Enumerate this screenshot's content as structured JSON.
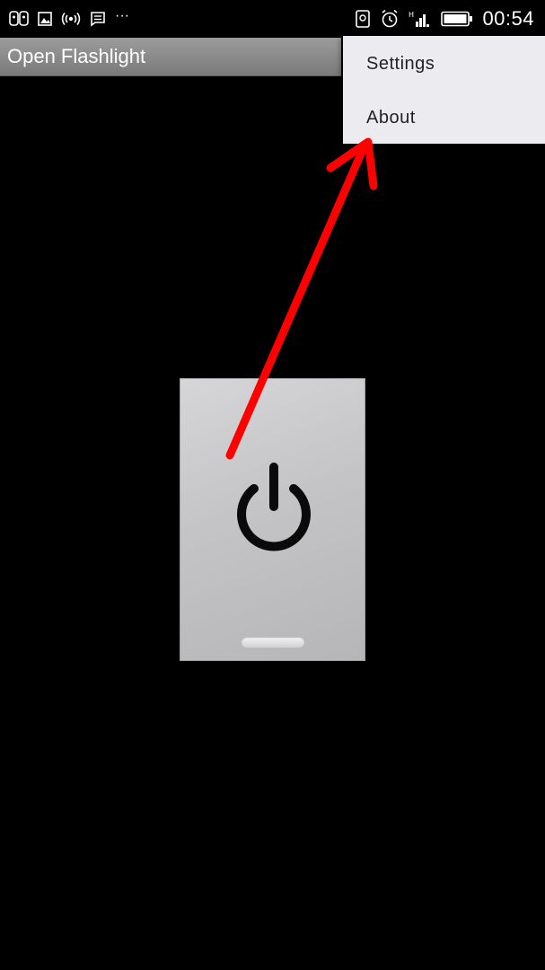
{
  "status_bar": {
    "time": "00:54",
    "overflow_indicator": "···",
    "left_icons": [
      "voicemail-icon",
      "gallery-icon",
      "hotspot-icon",
      "message-icon"
    ],
    "right_icons": [
      "sim-icon",
      "alarm-icon",
      "signal-icon",
      "battery-icon"
    ]
  },
  "action_bar": {
    "title": "Open Flashlight",
    "background": "#8a8a8a"
  },
  "overflow_menu": {
    "items": [
      {
        "label": "Settings"
      },
      {
        "label": "About"
      }
    ],
    "background": "#ececf0"
  },
  "power_switch": {
    "icon": "power-icon",
    "background": "#c8c8ca"
  },
  "annotation": {
    "type": "arrow",
    "color": "#ff0000"
  }
}
